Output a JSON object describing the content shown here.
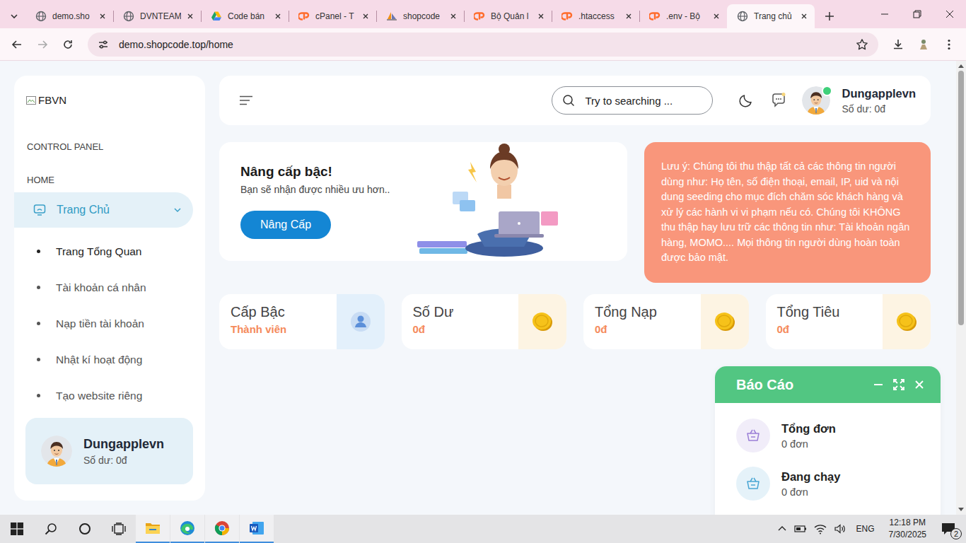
{
  "browser": {
    "tabs": [
      {
        "label": "demo.sho",
        "kind": "globe",
        "selected": false
      },
      {
        "label": "DVNTEAM",
        "kind": "globe",
        "selected": false
      },
      {
        "label": "Code bán",
        "kind": "drive",
        "selected": false
      },
      {
        "label": "cPanel - T",
        "kind": "cpanel",
        "selected": false
      },
      {
        "label": "shopcode",
        "kind": "pma",
        "selected": false
      },
      {
        "label": "Bộ Quản l",
        "kind": "cpanel",
        "selected": false
      },
      {
        "label": ".htaccess",
        "kind": "cpanel",
        "selected": false
      },
      {
        "label": ".env - Bộ",
        "kind": "cpanel",
        "selected": false
      },
      {
        "label": "Trang chủ",
        "kind": "globe",
        "selected": true
      }
    ],
    "url": "demo.shopcode.top/home",
    "bookmarked": false
  },
  "sidebar": {
    "logo_alt": "FBVN",
    "section": "CONTROL PANEL",
    "group": "HOME",
    "menu": {
      "label": "Trang Chủ",
      "expanded": true,
      "items": [
        {
          "label": "Trang Tổng Quan",
          "selected": true
        },
        {
          "label": "Tài khoản cá nhân",
          "selected": false
        },
        {
          "label": "Nạp tiền tài khoản",
          "selected": false
        },
        {
          "label": "Nhật kí hoạt động",
          "selected": false
        },
        {
          "label": "Tạo website riêng",
          "selected": false
        }
      ]
    },
    "user": {
      "name": "Dungapplevn",
      "balance": "Số dư: 0đ"
    }
  },
  "header": {
    "search_placeholder": "Try to searching ...",
    "user": {
      "name": "Dungapplevn",
      "balance": "Số dư: 0đ",
      "online": true
    }
  },
  "upgrade": {
    "title": "Nâng cấp bậc!",
    "subtitle": "Bạn sẽ nhận được nhiều ưu hơn..",
    "button": "Nâng Cấp"
  },
  "notice": "Lưu ý: Chúng tôi thu thập tất cả các thông tin người dùng như: Họ tên, số điện thoại, email, IP, uid và nội dung seeding cho mục đích chăm sóc khách hàng và xử lý các hành vi vi phạm nếu có. Chúng tôi KHÔNG thu thập hay lưu trữ các thông tin như: Tài khoản ngân hàng, MOMO.... Mọi thông tin người dùng hoàn toàn được bảo mật.",
  "stats": [
    {
      "label": "Cấp Bậc",
      "value": "Thành viên",
      "kind": "user"
    },
    {
      "label": "Số Dư",
      "value": "0đ",
      "kind": "coin"
    },
    {
      "label": "Tổng Nạp",
      "value": "0đ",
      "kind": "coin"
    },
    {
      "label": "Tổng Tiêu",
      "value": "0đ",
      "kind": "coin"
    }
  ],
  "report": {
    "title": "Báo Cáo",
    "items": [
      {
        "label": "Tổng đơn",
        "value": "0 đơn",
        "color": "#9b7fd6"
      },
      {
        "label": "Đang chạy",
        "value": "0 đơn",
        "color": "#4aa6d4"
      }
    ]
  },
  "taskbar": {
    "apps": [
      {
        "kind": "explorer",
        "running": true
      },
      {
        "kind": "edge",
        "running": true
      },
      {
        "kind": "chrome",
        "running": true
      },
      {
        "kind": "word",
        "running": true
      }
    ],
    "language": "ENG",
    "time": "12:18 PM",
    "date": "7/30/2025",
    "notifications": "2"
  }
}
